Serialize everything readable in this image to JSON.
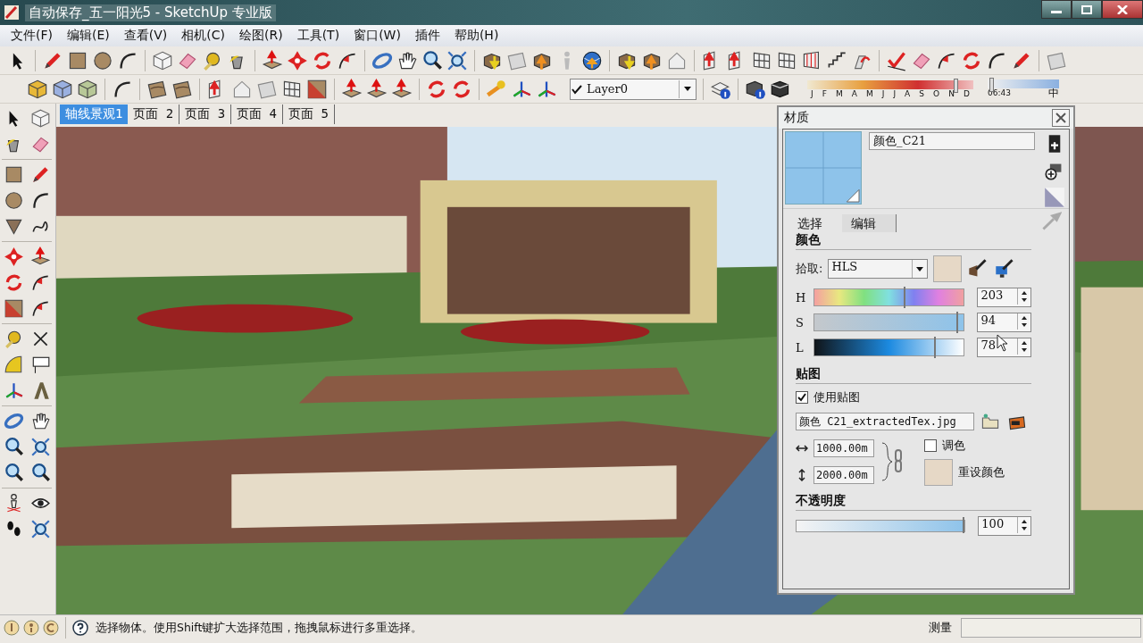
{
  "window": {
    "title": "自动保存_五一阳光5 - SketchUp 专业版"
  },
  "menu": [
    {
      "label": "文件(F)"
    },
    {
      "label": "编辑(E)"
    },
    {
      "label": "查看(V)"
    },
    {
      "label": "相机(C)"
    },
    {
      "label": "绘图(R)"
    },
    {
      "label": "工具(T)"
    },
    {
      "label": "窗口(W)"
    },
    {
      "label": "插件"
    },
    {
      "label": "帮助(H)"
    }
  ],
  "layer_select": {
    "value": "Layer0"
  },
  "shadow": {
    "months": [
      "J",
      "F",
      "M",
      "A",
      "M",
      "J",
      "J",
      "A",
      "S",
      "O",
      "N",
      "D"
    ],
    "month_slider": {
      "level": 0.88
    },
    "time_slider": {
      "level": 0.03
    },
    "time": "06:43",
    "time_label": "中"
  },
  "scene_tabs": [
    {
      "label": "轴线景观1",
      "selected": true
    },
    {
      "label": "页面 2",
      "selected": false
    },
    {
      "label": "页面 3",
      "selected": false
    },
    {
      "label": "页面 4",
      "selected": false
    },
    {
      "label": "页面 5",
      "selected": false
    }
  ],
  "materials": {
    "title": "材质",
    "name": "颜色_C21",
    "tabs": [
      {
        "label": "选择",
        "selected": false
      },
      {
        "label": "编辑",
        "selected": true
      }
    ],
    "color_heading": "颜色",
    "picker_label": "拾取:",
    "picker_mode": "HLS",
    "sliders": [
      {
        "label": "H",
        "kind": "hue",
        "level": 0.6,
        "value": "203"
      },
      {
        "label": "S",
        "kind": "saturation",
        "level": 0.95,
        "value": "94"
      },
      {
        "label": "L",
        "kind": "lightness",
        "level": 0.8,
        "value": "78"
      }
    ],
    "texture_heading": "贴图",
    "use_texture": {
      "label": "使用贴图",
      "checked": true
    },
    "texture_file": "颜色 C21_extractedTex.jpg",
    "width": "1000.00m",
    "height": "2000.00m",
    "colorize": {
      "label": "调色",
      "checked": false
    },
    "reset_label": "重设颜色",
    "opacity_heading": "不透明度",
    "opacity": {
      "level": 1.0,
      "value": "100"
    }
  },
  "status_bar": {
    "message": "选择物体。使用Shift键扩大选择范围，拖拽鼠标进行多重选择。",
    "measure_label": "测量"
  }
}
